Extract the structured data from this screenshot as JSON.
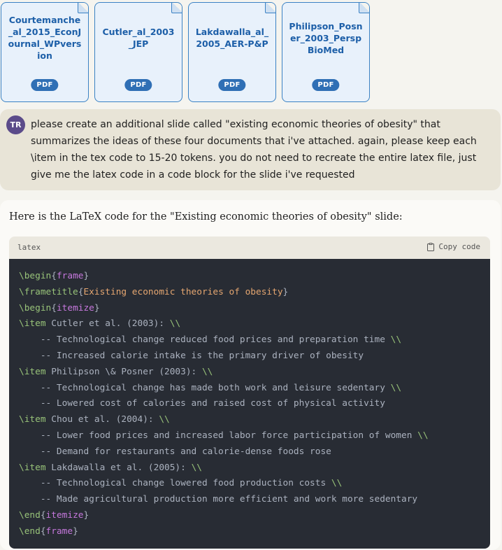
{
  "attachments": [
    {
      "name": "Courtemanche_al_2015_EconJournal_WPversion",
      "type": "PDF"
    },
    {
      "name": "Cutler_al_2003_JEP",
      "type": "PDF"
    },
    {
      "name": "Lakdawalla_al_2005_AER-P&P",
      "type": "PDF"
    },
    {
      "name": "Philipson_Posner_2003_PerspBioMed",
      "type": "PDF"
    }
  ],
  "user": {
    "initials": "TR",
    "message": "please create an additional slide called \"existing economic theories of obesity\" that summarizes the ideas of these four documents that i've attached. again, please keep each \\item in the tex code to 15-20 tokens. you do not need to recreate the entire latex file, just give me the latex code in a code block for the slide i've requested"
  },
  "assistant": {
    "intro": "Here is the LaTeX code for the \"Existing economic theories of obesity\" slide:",
    "code_language": "latex",
    "copy_label": "Copy code",
    "code_lines": [
      {
        "cmd": "\\begin",
        "arg": "frame",
        "rest": "",
        "end": ""
      },
      {
        "cmd": "\\frametitle",
        "arg": "Existing economic theories of obesity",
        "rest": "",
        "end": "",
        "title": true
      },
      {
        "cmd": "\\begin",
        "arg": "itemize",
        "rest": "",
        "end": ""
      },
      {
        "cmd": "\\item",
        "arg": "",
        "rest": " Cutler et al. (2003): ",
        "end": "\\\\"
      },
      {
        "cmd": "",
        "arg": "",
        "rest": "    -- Technological change reduced food prices and preparation time ",
        "end": "\\\\"
      },
      {
        "cmd": "",
        "arg": "",
        "rest": "    -- Increased calorie intake is the primary driver of obesity",
        "end": ""
      },
      {
        "cmd": "\\item",
        "arg": "",
        "rest": " Philipson \\& Posner (2003): ",
        "end": "\\\\"
      },
      {
        "cmd": "",
        "arg": "",
        "rest": "    -- Technological change has made both work and leisure sedentary ",
        "end": "\\\\"
      },
      {
        "cmd": "",
        "arg": "",
        "rest": "    -- Lowered cost of calories and raised cost of physical activity",
        "end": ""
      },
      {
        "cmd": "\\item",
        "arg": "",
        "rest": " Chou et al. (2004): ",
        "end": "\\\\"
      },
      {
        "cmd": "",
        "arg": "",
        "rest": "    -- Lower food prices and increased labor force participation of women ",
        "end": "\\\\"
      },
      {
        "cmd": "",
        "arg": "",
        "rest": "    -- Demand for restaurants and calorie-dense foods rose",
        "end": ""
      },
      {
        "cmd": "\\item",
        "arg": "",
        "rest": " Lakdawalla et al. (2005): ",
        "end": "\\\\"
      },
      {
        "cmd": "",
        "arg": "",
        "rest": "    -- Technological change lowered food production costs ",
        "end": "\\\\"
      },
      {
        "cmd": "",
        "arg": "",
        "rest": "    -- Made agricultural production more efficient and work more sedentary",
        "end": ""
      },
      {
        "cmd": "\\end",
        "arg": "itemize",
        "rest": "",
        "end": ""
      },
      {
        "cmd": "\\end",
        "arg": "frame",
        "rest": "",
        "end": ""
      }
    ]
  }
}
